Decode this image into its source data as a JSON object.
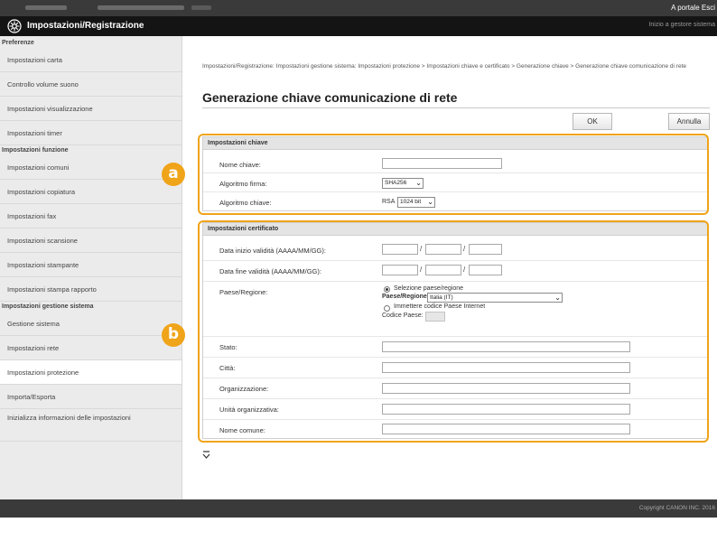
{
  "header": {
    "portal_link": "A portale  Esci",
    "app_title": "Impostazioni/Registrazione",
    "home_link": "Inizio a gestore sistema"
  },
  "sidebar": {
    "groups": [
      {
        "title": "Preferenze",
        "items": [
          "Impostazioni carta",
          "Controllo volume suono",
          "Impostazioni visualizzazione",
          "Impostazioni timer"
        ]
      },
      {
        "title": "Impostazioni funzione",
        "items": [
          "Impostazioni comuni",
          "Impostazioni copiatura",
          "Impostazioni fax",
          "Impostazioni scansione",
          "Impostazioni stampante",
          "Impostazioni stampa rapporto"
        ]
      },
      {
        "title": "Impostazioni gestione sistema",
        "items": [
          "Gestione sistema",
          "Impostazioni rete",
          "Impostazioni protezione",
          "Importa/Esporta",
          "Inizializza informazioni delle impostazioni"
        ]
      }
    ],
    "active_item": "Impostazioni protezione"
  },
  "main": {
    "breadcrumb": "Impostazioni/Registrazione: Impostazioni gestione sistema: Impostazioni protezione > Impostazioni chiave e certificato > Generazione chiave > Generazione chiave comunicazione di rete",
    "title": "Generazione chiave comunicazione di rete",
    "ok_label": "OK",
    "cancel_label": "Annulla",
    "key_section": {
      "title": "Impostazioni chiave",
      "key_name_label": "Nome chiave:",
      "key_name_value": "",
      "sign_algo_label": "Algoritmo firma:",
      "sign_algo_value": "SHA256",
      "key_algo_label": "Algoritmo chiave:",
      "key_algo_type": "RSA",
      "key_algo_value": "1024 bit"
    },
    "cert_section": {
      "title": "Impostazioni certificato",
      "valid_start_label": "Data inizio validità (AAAA/MM/GG):",
      "valid_end_label": "Data fine validità (AAAA/MM/GG):",
      "country_label": "Paese/Regione:",
      "radio_select_label": "Selezione paese/regione",
      "country_select_label": "Paese/Regione:",
      "country_select_value": "Italia (IT)",
      "radio_internet_label": "Immettere codice Paese Internet",
      "country_code_label": "Codice Paese:",
      "country_code_value": "",
      "state_label": "Stato:",
      "city_label": "Città:",
      "org_label": "Organizzazione:",
      "org_unit_label": "Unità organizzativa:",
      "common_name_label": "Nome comune:"
    },
    "slash": "/"
  },
  "callouts": {
    "a": "a",
    "b": "b"
  },
  "back_to_top_icon": "arrow-up-to-top-icon",
  "footer": {
    "copyright": "Copyright CANON INC. 2016"
  },
  "colors": {
    "accent": "#f0a419",
    "header_bg": "#141414",
    "sidebar_bg": "#ebebeb"
  }
}
